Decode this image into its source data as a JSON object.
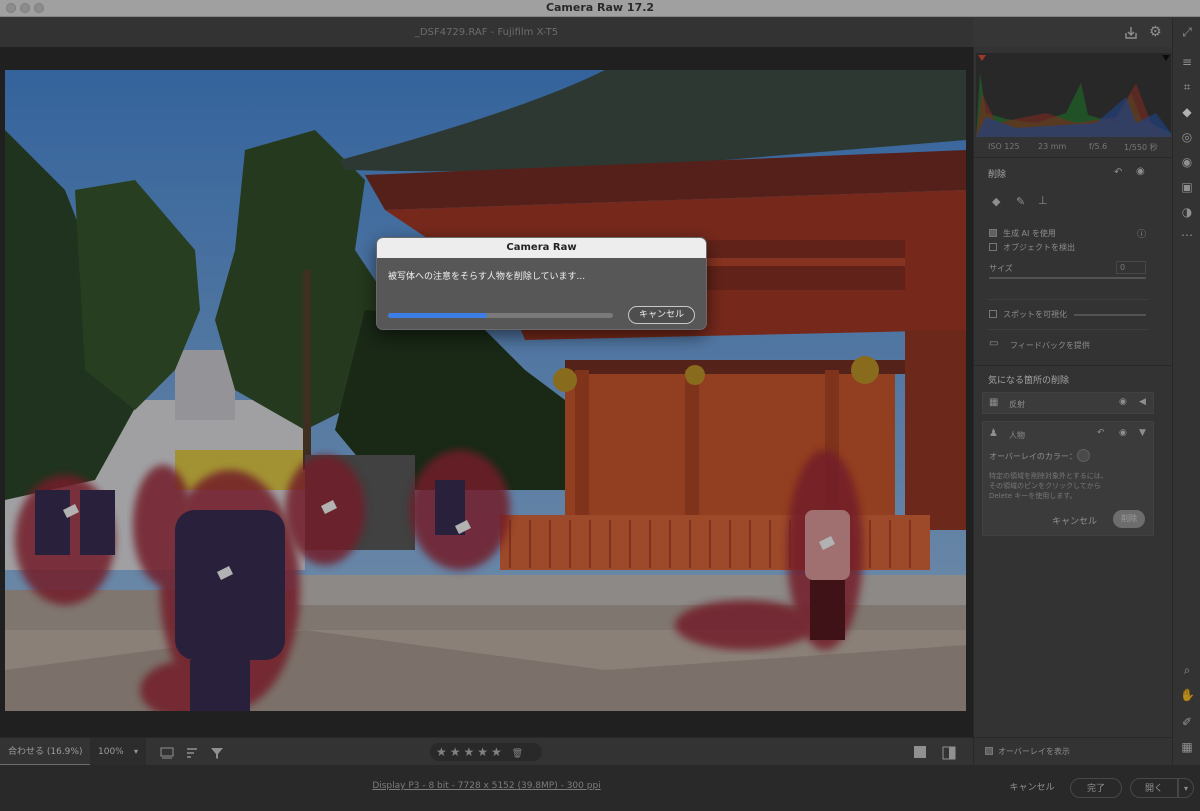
{
  "window": {
    "title": "Camera Raw 17.2"
  },
  "file": {
    "name": "_DSF4729.RAF",
    "camera": "Fujifilm X-T5",
    "separator": "-"
  },
  "dialog": {
    "title": "Camera Raw",
    "message": "被写体への注意をそらす人物を削除しています...",
    "progress": 0.44,
    "cancel_label": "キャンセル"
  },
  "histogram": {
    "iso": "ISO 125",
    "focal": "23 mm",
    "aperture": "f/5.6",
    "shutter": "1/550 秒"
  },
  "remove_panel": {
    "title": "削除",
    "generative_ai_label": "生成 AI を使用",
    "generative_ai_checked": true,
    "detect_objects_label": "オブジェクトを検出",
    "detect_objects_checked": false,
    "size_label": "サイズ",
    "size_value": "0",
    "visualize_spots_label": "スポットを可視化",
    "feedback_label": "フィードバックを提供"
  },
  "distraction": {
    "title": "気になる箇所の削除",
    "reflection_label": "反射",
    "people_label": "人物",
    "overlay_color_label": "オーバーレイのカラー：",
    "help_text": [
      "特定の領域を削除対象外とするには、",
      "その領域のピンをクリックしてから",
      "Delete キーを使用します。"
    ],
    "cancel_label": "キャンセル",
    "remove_label": "削除"
  },
  "statusbar": {
    "fit_label": "合わせる (16.9%)",
    "zoom_label": "100%",
    "stars": "★★★★★",
    "trash": "🗑"
  },
  "overlay_toggle_label": "オーバーレイを表示",
  "footer": {
    "info": "Display P3 - 8 bit - 7728 x 5152 (39.8MP) - 300 ppi",
    "cancel_label": "キャンセル",
    "done_label": "完了",
    "open_label": "開く"
  },
  "colors": {
    "accent": "#3d7de6",
    "mask": "#b0283a",
    "panel": "#4a4a4a"
  }
}
